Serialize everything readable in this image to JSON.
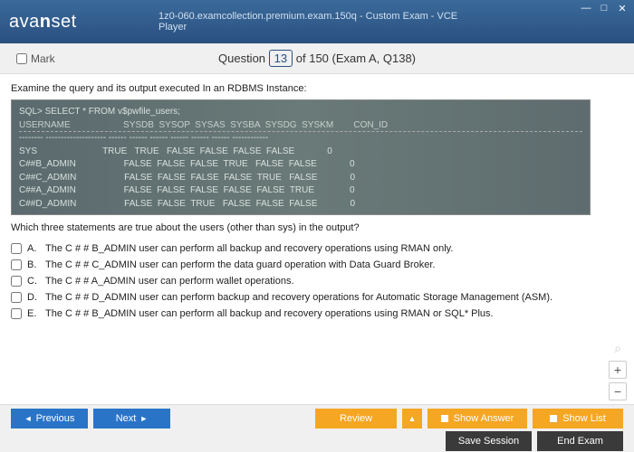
{
  "window": {
    "logo_html": "avanset",
    "title": "1z0-060.examcollection.premium.exam.150q - Custom Exam - VCE Player"
  },
  "toolbar": {
    "mark_label": "Mark",
    "question_word": "Question",
    "question_num": "13",
    "of_total": "of 150 (Exam A, Q138)"
  },
  "content": {
    "prompt1": "Examine the query and its output executed In an RDBMS Instance:",
    "sql_cmd": "SQL> SELECT * FROM v$pwfile_users;",
    "sql_head": "USERNAME                     SYSDB  SYSOP  SYSAS  SYSBA  SYSDG  SYSKM        CON_ID",
    "sql_rule": "-------- -------------------- ------ ------ ------ ------ ------ ------ ------------",
    "sql_r1": "SYS                          TRUE   TRUE   FALSE  FALSE  FALSE  FALSE             0",
    "sql_r2": "C##B_ADMIN                   FALSE  FALSE  FALSE  TRUE   FALSE  FALSE             0",
    "sql_r3": "C##C_ADMIN                   FALSE  FALSE  FALSE  FALSE  TRUE   FALSE             0",
    "sql_r4": "C##A_ADMIN                   FALSE  FALSE  FALSE  FALSE  FALSE  TRUE              0",
    "sql_r5": "C##D_ADMIN                   FALSE  FALSE  TRUE   FALSE  FALSE  FALSE             0",
    "prompt2": "Which three statements are true about the users (other than sys) in the output?",
    "options": [
      {
        "letter": "A.",
        "text": "The C # # B_ADMIN user can perform all backup and recovery operations using RMAN only."
      },
      {
        "letter": "B.",
        "text": "The C # # C_ADMIN user can perform the data guard operation with Data Guard Broker."
      },
      {
        "letter": "C.",
        "text": "The C # # A_ADMIN user can perform wallet operations."
      },
      {
        "letter": "D.",
        "text": "The C # # D_ADMIN user can perform backup and recovery operations for Automatic Storage Management (ASM)."
      },
      {
        "letter": "E.",
        "text": "The C # # B_ADMIN user can perform all backup and recovery operations using RMAN or SQL* Plus."
      }
    ]
  },
  "footer": {
    "previous": "Previous",
    "next": "Next",
    "review": "Review",
    "show_answer": "Show Answer",
    "show_list": "Show List",
    "save_session": "Save Session",
    "end_exam": "End Exam"
  }
}
